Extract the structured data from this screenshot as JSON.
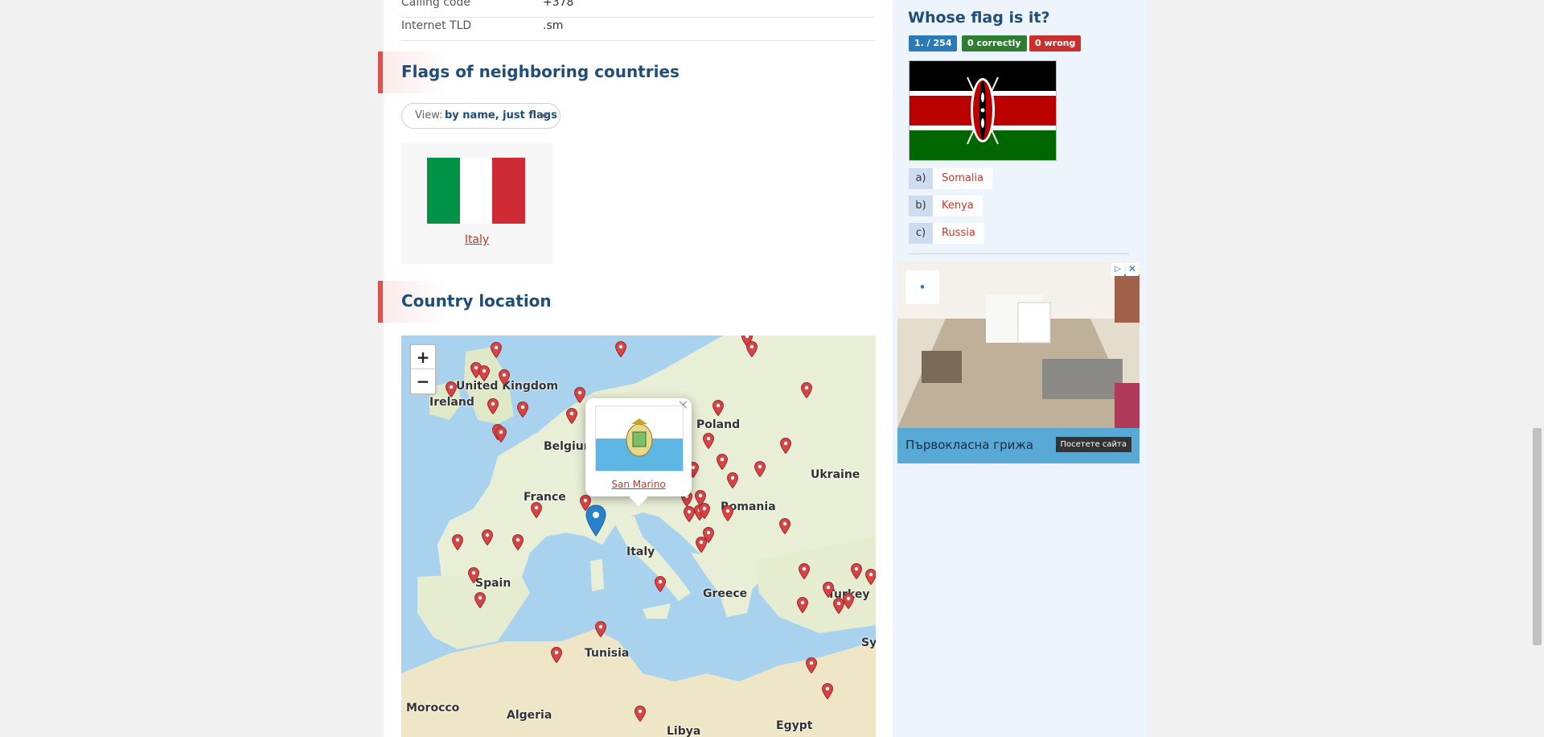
{
  "info": [
    {
      "key": "Calling code",
      "value": "+378"
    },
    {
      "key": "Internet TLD",
      "value": ".sm"
    }
  ],
  "neighbors": {
    "heading": "Flags of neighboring countries",
    "view_label": "View:",
    "view_value": "by name, just flags",
    "countries": [
      {
        "name": "Italy"
      }
    ]
  },
  "location": {
    "heading": "Country location",
    "zoom_in": "+",
    "zoom_out": "−",
    "popup_country": "San Marino",
    "popup_close": "×",
    "labels": [
      "United Kingdom",
      "Ireland",
      "Belgium",
      "Poland",
      "France",
      "Ukraine",
      "Romania",
      "Italy",
      "Spain",
      "Greece",
      "Turkey",
      "Tunisia",
      "Morocco",
      "Algeria",
      "Libya",
      "Egypt",
      "Syria"
    ]
  },
  "quiz": {
    "title": "Whose flag is it?",
    "progress": "1. / 254",
    "correct": "0  correctly",
    "wrong": "0  wrong",
    "answers": [
      {
        "letter": "a)",
        "text": "Somalia"
      },
      {
        "letter": "b)",
        "text": "Kenya"
      },
      {
        "letter": "c)",
        "text": "Russia"
      }
    ]
  },
  "ad": {
    "caption": "Първокласна грижа",
    "button": "Посетете сайта",
    "close": "✕",
    "info": "▷"
  },
  "colors": {
    "accent": "#d9534f",
    "heading": "#1f4e79",
    "link": "#c0392b",
    "badge_blue": "#2a7ab8",
    "badge_green": "#2e7d32",
    "badge_red": "#c9302c"
  }
}
